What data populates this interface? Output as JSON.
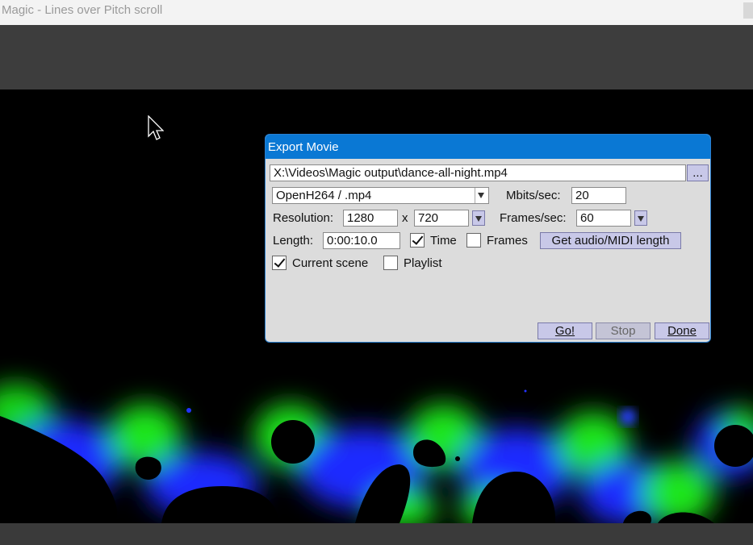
{
  "window": {
    "title": "Magic - Lines over Pitch scroll"
  },
  "dialog": {
    "title": "Export Movie",
    "file_path": "X:\\Videos\\Magic output\\dance-all-night.mp4",
    "browse_label": "...",
    "codec": "OpenH264 / .mp4",
    "mbits_label": "Mbits/sec:",
    "mbits_value": "20",
    "resolution_label": "Resolution:",
    "res_width": "1280",
    "res_x": "x",
    "res_height": "720",
    "fps_label": "Frames/sec:",
    "fps_value": "60",
    "length_label": "Length:",
    "length_value": "0:00:10.0",
    "time_label": "Time",
    "time_checked": true,
    "frames_label": "Frames",
    "frames_checked": false,
    "get_length_label": "Get audio/MIDI length",
    "current_scene_label": "Current scene",
    "current_scene_checked": true,
    "playlist_label": "Playlist",
    "playlist_checked": false,
    "go_label": "Go!",
    "stop_label": "Stop",
    "done_label": "Done"
  },
  "colors": {
    "title_bar": "#0a78d4",
    "dialog_bg": "#dcdcdc",
    "button_bg": "#c8c8e8",
    "blob_green": "#1ee61e",
    "blob_blue": "#1a2cff"
  }
}
